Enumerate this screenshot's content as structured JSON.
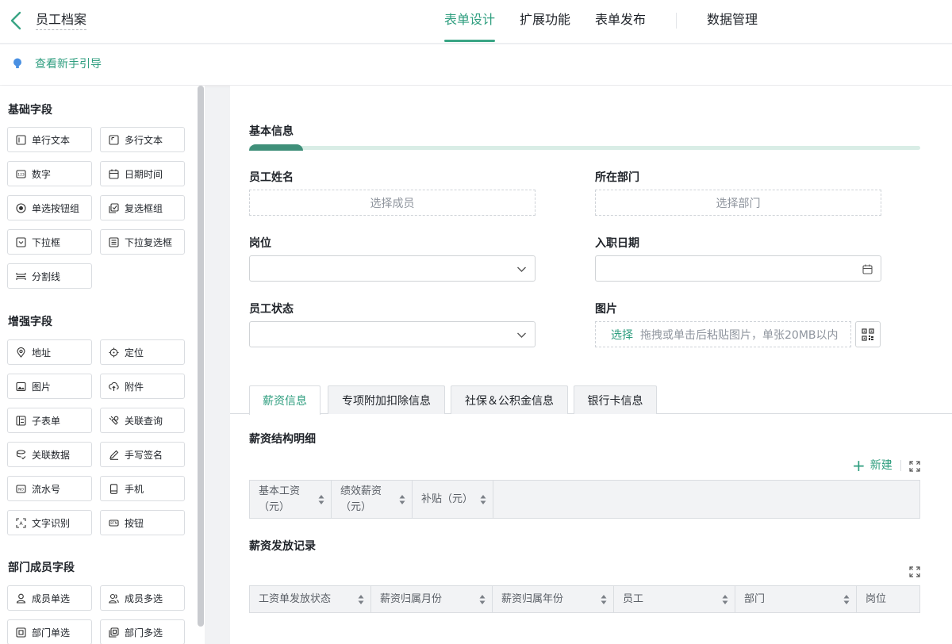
{
  "header": {
    "title": "员工档案",
    "tabs": [
      {
        "label": "表单设计",
        "active": true
      },
      {
        "label": "扩展功能",
        "active": false
      },
      {
        "label": "表单发布",
        "active": false
      },
      {
        "label": "数据管理",
        "active": false
      }
    ],
    "accent_color": "#2f9e7f"
  },
  "guide": {
    "text": "查看新手引导"
  },
  "sidebar": {
    "groups": [
      {
        "title": "基础字段",
        "items": [
          {
            "label": "单行文本",
            "icon": "single-line-text-icon"
          },
          {
            "label": "多行文本",
            "icon": "multi-line-text-icon"
          },
          {
            "label": "数字",
            "icon": "number-icon"
          },
          {
            "label": "日期时间",
            "icon": "calendar-icon"
          },
          {
            "label": "单选按钮组",
            "icon": "radio-icon"
          },
          {
            "label": "复选框组",
            "icon": "checkbox-icon"
          },
          {
            "label": "下拉框",
            "icon": "dropdown-icon"
          },
          {
            "label": "下拉复选框",
            "icon": "dropdown-multi-icon"
          },
          {
            "label": "分割线",
            "icon": "divider-icon"
          }
        ]
      },
      {
        "title": "增强字段",
        "items": [
          {
            "label": "地址",
            "icon": "location-pin-icon"
          },
          {
            "label": "定位",
            "icon": "crosshair-icon"
          },
          {
            "label": "图片",
            "icon": "image-icon"
          },
          {
            "label": "附件",
            "icon": "upload-cloud-icon"
          },
          {
            "label": "子表单",
            "icon": "subform-icon"
          },
          {
            "label": "关联查询",
            "icon": "link-query-icon"
          },
          {
            "label": "关联数据",
            "icon": "link-data-icon"
          },
          {
            "label": "手写签名",
            "icon": "pen-icon"
          },
          {
            "label": "流水号",
            "icon": "serial-number-icon"
          },
          {
            "label": "手机",
            "icon": "mobile-icon"
          },
          {
            "label": "文字识别",
            "icon": "ocr-icon"
          },
          {
            "label": "按钮",
            "icon": "button-icon"
          }
        ]
      },
      {
        "title": "部门成员字段",
        "items": [
          {
            "label": "成员单选",
            "icon": "user-icon"
          },
          {
            "label": "成员多选",
            "icon": "users-icon"
          },
          {
            "label": "部门单选",
            "icon": "department-icon"
          },
          {
            "label": "部门多选",
            "icon": "departments-icon"
          }
        ]
      }
    ]
  },
  "form": {
    "section_title": "基本信息",
    "fields": {
      "name": {
        "label": "员工姓名",
        "placeholder": "选择成员"
      },
      "department": {
        "label": "所在部门",
        "placeholder": "选择部门"
      },
      "position": {
        "label": "岗位"
      },
      "hire_date": {
        "label": "入职日期"
      },
      "status": {
        "label": "员工状态"
      },
      "photo": {
        "label": "图片",
        "pick": "选择",
        "hint": "拖拽或单击后粘贴图片，单张20MB以内"
      }
    },
    "subtabs": [
      {
        "label": "薪资信息",
        "active": true
      },
      {
        "label": "专项附加扣除信息",
        "active": false
      },
      {
        "label": "社保＆公积金信息",
        "active": false
      },
      {
        "label": "银行卡信息",
        "active": false
      }
    ],
    "salary_structure": {
      "title": "薪资结构明细",
      "new_label": "新建",
      "columns": [
        {
          "line1": "基本工资",
          "line2": "（元）"
        },
        {
          "line1": "绩效薪资",
          "line2": "（元）"
        },
        {
          "line1": "补贴（元）",
          "line2": ""
        }
      ]
    },
    "salary_records": {
      "title": "薪资发放记录",
      "columns": [
        "工资单发放状态",
        "薪资归属月份",
        "薪资归属年份",
        "员工",
        "部门",
        "岗位"
      ]
    }
  }
}
